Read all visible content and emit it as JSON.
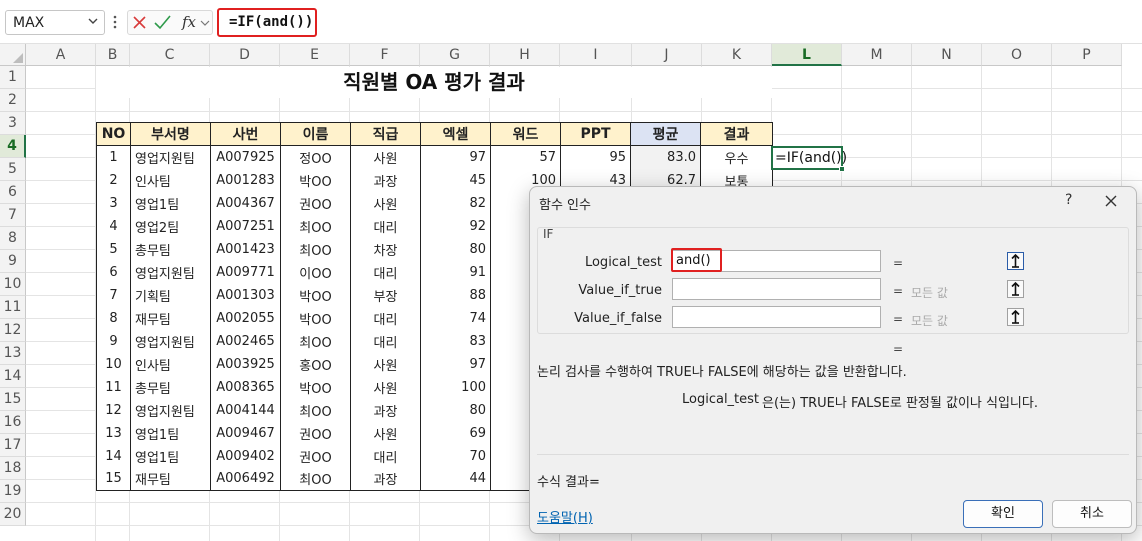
{
  "formula_bar": {
    "name_box": "MAX",
    "fx": "fx",
    "formula": "=IF(and())"
  },
  "grid": {
    "columns": [
      "A",
      "B",
      "C",
      "D",
      "E",
      "F",
      "G",
      "H",
      "I",
      "J",
      "K",
      "L",
      "M",
      "N",
      "O",
      "P"
    ],
    "rows": [
      "1",
      "2",
      "3",
      "4",
      "5",
      "6",
      "7",
      "8",
      "9",
      "10",
      "11",
      "12",
      "13",
      "14",
      "15",
      "16",
      "17",
      "18",
      "19",
      "20"
    ],
    "active_cell_text": "=IF(and())"
  },
  "sheet": {
    "title": "직원별 OA 평가 결과",
    "headers": [
      "NO",
      "부서명",
      "사번",
      "이름",
      "직급",
      "엑셀",
      "워드",
      "PPT",
      "평균",
      "결과"
    ],
    "rows": [
      [
        "1",
        "영업지원팀",
        "A007925",
        "정OO",
        "사원",
        "97",
        "57",
        "95",
        "83.0",
        "우수"
      ],
      [
        "2",
        "인사팀",
        "A001283",
        "박OO",
        "과장",
        "45",
        "100",
        "43",
        "62.7",
        "보통"
      ],
      [
        "3",
        "영업1팀",
        "A004367",
        "권OO",
        "사원",
        "82",
        "",
        "",
        "",
        ""
      ],
      [
        "4",
        "영업2팀",
        "A007251",
        "최OO",
        "대리",
        "92",
        "",
        "",
        "",
        ""
      ],
      [
        "5",
        "총무팀",
        "A001423",
        "최OO",
        "차장",
        "80",
        "",
        "",
        "",
        ""
      ],
      [
        "6",
        "영업지원팀",
        "A009771",
        "이OO",
        "대리",
        "91",
        "",
        "",
        "",
        ""
      ],
      [
        "7",
        "기획팀",
        "A001303",
        "박OO",
        "부장",
        "88",
        "",
        "",
        "",
        ""
      ],
      [
        "8",
        "재무팀",
        "A002055",
        "박OO",
        "대리",
        "74",
        "",
        "",
        "",
        ""
      ],
      [
        "9",
        "영업지원팀",
        "A002465",
        "최OO",
        "대리",
        "83",
        "",
        "",
        "",
        ""
      ],
      [
        "10",
        "인사팀",
        "A003925",
        "홍OO",
        "사원",
        "97",
        "",
        "",
        "",
        ""
      ],
      [
        "11",
        "총무팀",
        "A008365",
        "박OO",
        "사원",
        "100",
        "",
        "",
        "",
        ""
      ],
      [
        "12",
        "영업지원팀",
        "A004144",
        "최OO",
        "과장",
        "80",
        "",
        "",
        "",
        ""
      ],
      [
        "13",
        "영업1팀",
        "A009467",
        "권OO",
        "사원",
        "69",
        "",
        "",
        "",
        ""
      ],
      [
        "14",
        "영업1팀",
        "A009402",
        "권OO",
        "대리",
        "70",
        "",
        "",
        "",
        ""
      ],
      [
        "15",
        "재무팀",
        "A006492",
        "최OO",
        "과장",
        "44",
        "",
        "",
        "",
        ""
      ]
    ]
  },
  "dialog": {
    "title": "함수 인수",
    "help": "?",
    "function_name": "IF",
    "args": [
      {
        "label": "Logical_test",
        "value": "and()",
        "result": ""
      },
      {
        "label": "Value_if_true",
        "value": "",
        "result": "모든 값"
      },
      {
        "label": "Value_if_false",
        "value": "",
        "result": "모든 값"
      }
    ],
    "eq": "=",
    "description": "논리 검사를 수행하여 TRUE나 FALSE에 해당하는 값을 반환합니다.",
    "arg_desc_name": "Logical_test",
    "arg_desc_text": "은(는) TRUE나 FALSE로 판정될 값이나 식입니다.",
    "result_label": "수식 결과=",
    "help_link": "도움말(H)",
    "ok": "확인",
    "cancel": "취소"
  },
  "colors": {
    "accent": "#217346",
    "highlight": "#e02020",
    "header_fill": "#fff2cc",
    "avg_header_fill": "#dce3f3"
  }
}
